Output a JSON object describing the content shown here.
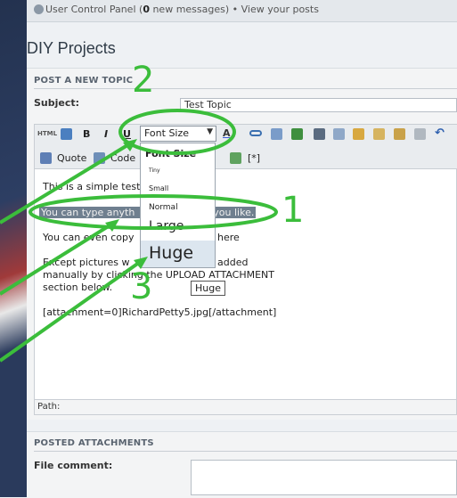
{
  "topbar": {
    "ucp_label": "User Control Panel",
    "new_messages_count": "0",
    "new_messages_suffix": " new messages)",
    "open_paren": " (",
    "separator": " • ",
    "view_posts_label": "View your posts"
  },
  "forum_title": "DIY Projects",
  "post_section": {
    "heading": "POST A NEW TOPIC",
    "subject_label": "Subject:",
    "subject_value": "Test Topic"
  },
  "toolbar": {
    "html_label": "HTML",
    "bold_label": "B",
    "italic_label": "I",
    "underline_label": "U",
    "font_size_label": "Font Size",
    "font_size_arrow": "▼",
    "quote_label": "Quote",
    "code_label": "Code",
    "list_item_label": "[*]"
  },
  "font_size_dropdown": {
    "header": "Font Size",
    "options": [
      "Tiny",
      "Small",
      "Normal",
      "Large",
      "Huge"
    ],
    "tooltip": "Huge"
  },
  "editor": {
    "lines": [
      "This is a simple test",
      "You can type anyth",
      "you like.",
      "You can even copy",
      "here",
      "Except pictures w",
      "added",
      "manually by clicking the UPLOAD ATTACHMENT",
      "section below.",
      "[attachment=0]RichardPetty5.jpg[/attachment]"
    ],
    "path_label": "Path:"
  },
  "attachments_section": {
    "heading": "POSTED ATTACHMENTS",
    "file_comment_label": "File comment:",
    "file_comment_value": ""
  },
  "annotations": {
    "number_1": "1",
    "number_2": "2",
    "number_3": "3",
    "color": "#3bbd3b"
  },
  "colors": {
    "highlight_bg": "#6f7f8f",
    "dropdown_hover": "#dce6ef",
    "annotation_green": "#3bbd3b"
  }
}
